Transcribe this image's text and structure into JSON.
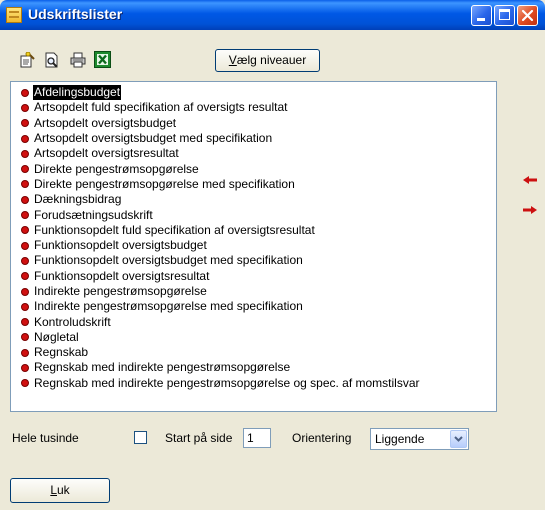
{
  "window": {
    "title": "Udskriftslister"
  },
  "toolbar": {
    "icons": [
      "wizard-icon",
      "print-preview-icon",
      "printer-icon",
      "excel-icon"
    ],
    "choose_levels_label": "Vælg niveauer",
    "choose_levels_mnemonic": "V"
  },
  "report_list": {
    "selected_index": 0,
    "items": [
      "Afdelingsbudget",
      "Artsopdelt fuld specifikation af oversigts resultat",
      "Artsopdelt oversigtsbudget",
      "Artsopdelt oversigtsbudget med specifikation",
      "Artsopdelt oversigtsresultat",
      "Direkte pengestrømsopgørelse",
      "Direkte pengestrømsopgørelse med specifikation",
      "Dækningsbidrag",
      "Forudsætningsudskrift",
      "Funktionsopdelt fuld specifikation af oversigtsresultat",
      "Funktionsopdelt oversigtsbudget",
      "Funktionsopdelt oversigtsbudget med specifikation",
      "Funktionsopdelt oversigtsresultat",
      "Indirekte pengestrømsopgørelse",
      "Indirekte pengestrømsopgørelse med specifikation",
      "Kontroludskrift",
      "Nøgletal",
      "Regnskab",
      "Regnskab med indirekte pengestrømsopgørelse",
      "Regnskab med indirekte pengestrømsopgørelse og spec. af momstilsvar"
    ]
  },
  "options": {
    "whole_thousands_label": "Hele tusinde",
    "whole_thousands_checked": false,
    "start_page_label": "Start på side",
    "start_page_value": "1",
    "orientation_label": "Orientering",
    "orientation_value": "Liggende"
  },
  "footer": {
    "close_label": "Luk",
    "close_mnemonic": "L"
  }
}
